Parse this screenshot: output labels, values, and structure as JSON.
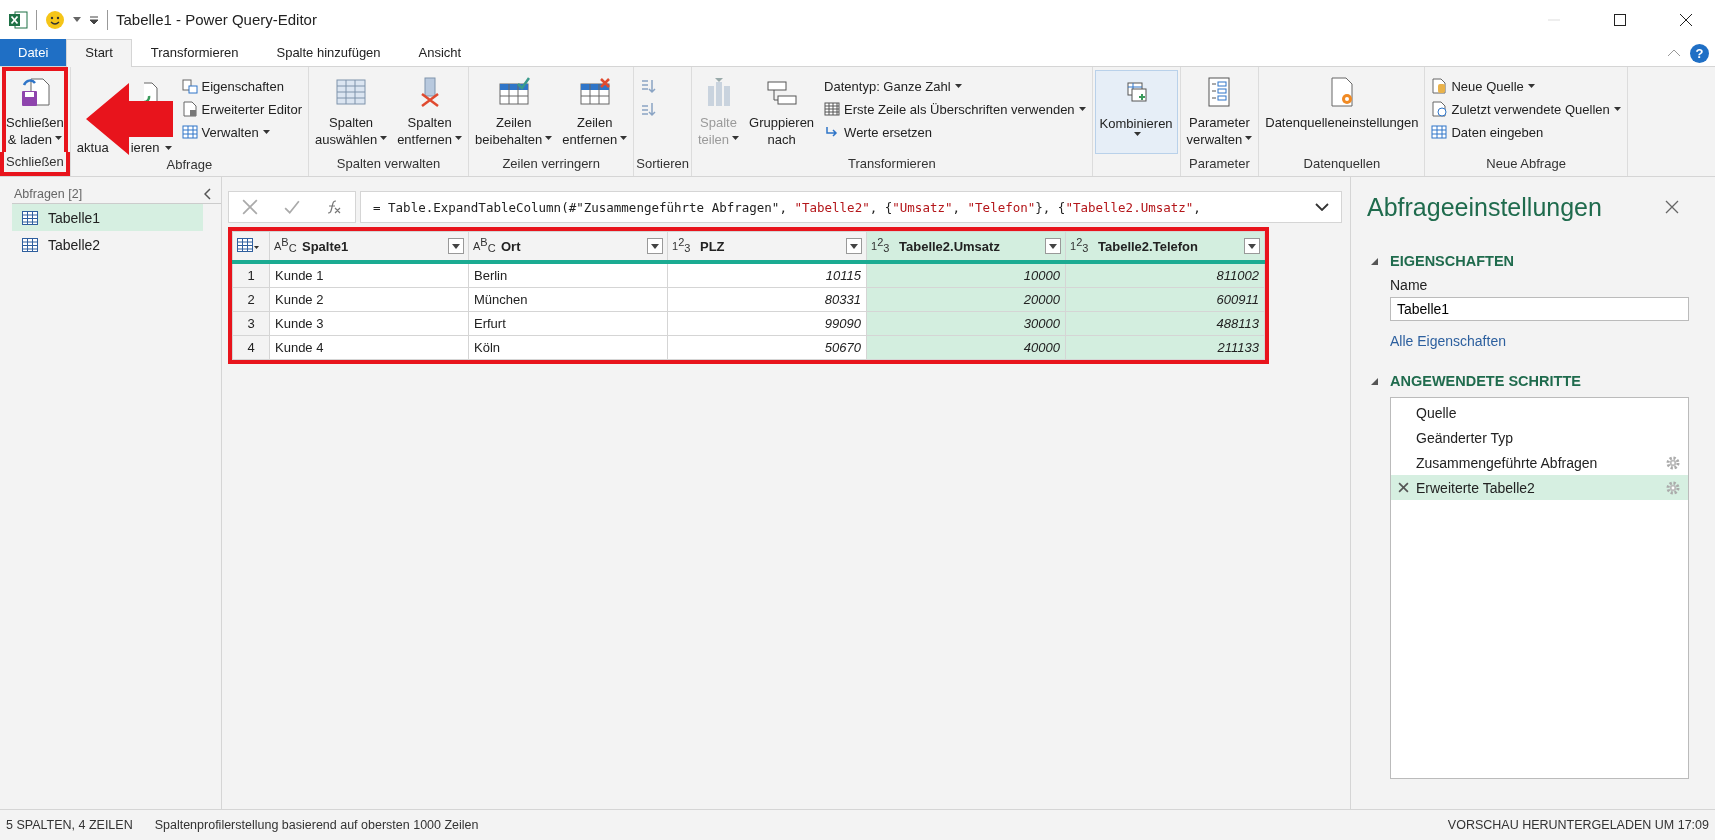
{
  "title_bar": {
    "title": "Tabelle1 - Power Query-Editor",
    "help_label": "?"
  },
  "tabs": [
    {
      "label": "Datei",
      "kind": "file",
      "selected": false
    },
    {
      "label": "Start",
      "kind": "tab",
      "selected": true
    },
    {
      "label": "Transformieren",
      "kind": "tab",
      "selected": false
    },
    {
      "label": "Spalte hinzufügen",
      "kind": "tab",
      "selected": false
    },
    {
      "label": "Ansicht",
      "kind": "tab",
      "selected": false
    }
  ],
  "ribbon": {
    "groups": [
      {
        "label": "Schließen",
        "buttons": [
          {
            "kind": "large",
            "lines": [
              "Schließen",
              "& laden"
            ],
            "dropdown": true,
            "disabled": false,
            "highlighted": false
          }
        ]
      },
      {
        "label": "Abfrage",
        "buttons": [
          {
            "kind": "large_covered",
            "lines": [
              "aktua",
              "ieren"
            ],
            "dropdown": true,
            "disabled": false,
            "highlighted": false
          },
          {
            "kind": "small",
            "lines": [
              "Eigenschaften"
            ],
            "dropdown": false,
            "disabled": false,
            "highlighted": false
          },
          {
            "kind": "small",
            "lines": [
              "Erweiterter Editor"
            ],
            "dropdown": false,
            "disabled": false,
            "highlighted": false
          },
          {
            "kind": "small",
            "lines": [
              "Verwalten"
            ],
            "dropdown": true,
            "disabled": false,
            "highlighted": false
          }
        ]
      },
      {
        "label": "Spalten verwalten",
        "buttons": [
          {
            "kind": "large",
            "lines": [
              "Spalten",
              "auswählen"
            ],
            "dropdown": true,
            "disabled": false,
            "highlighted": false
          },
          {
            "kind": "large",
            "lines": [
              "Spalten",
              "entfernen"
            ],
            "dropdown": true,
            "disabled": false,
            "highlighted": false
          }
        ]
      },
      {
        "label": "Zeilen verringern",
        "buttons": [
          {
            "kind": "large",
            "lines": [
              "Zeilen",
              "beibehalten"
            ],
            "dropdown": true,
            "disabled": false,
            "highlighted": false
          },
          {
            "kind": "large",
            "lines": [
              "Zeilen",
              "entfernen"
            ],
            "dropdown": true,
            "disabled": false,
            "highlighted": false
          }
        ]
      },
      {
        "label": "Sortieren",
        "buttons": [
          {
            "kind": "icon",
            "dropdown": false,
            "disabled": false,
            "highlighted": false
          },
          {
            "kind": "icon",
            "dropdown": false,
            "disabled": false,
            "highlighted": false
          }
        ]
      },
      {
        "label": "Transformieren",
        "buttons": [
          {
            "kind": "large",
            "lines": [
              "Spalte",
              "teilen"
            ],
            "dropdown": true,
            "disabled": true,
            "highlighted": false
          },
          {
            "kind": "large",
            "lines": [
              "Gruppieren",
              "nach"
            ],
            "dropdown": false,
            "disabled": false,
            "highlighted": false
          },
          {
            "kind": "small",
            "lines": [
              "Datentyp: Ganze Zahl"
            ],
            "dropdown": true,
            "disabled": false,
            "highlighted": false
          },
          {
            "kind": "small",
            "lines": [
              "Erste Zeile als Überschriften verwenden"
            ],
            "dropdown": true,
            "disabled": false,
            "highlighted": false
          },
          {
            "kind": "small",
            "lines": [
              "Werte ersetzen"
            ],
            "dropdown": false,
            "disabled": false,
            "highlighted": false
          }
        ]
      },
      {
        "buttons": [
          {
            "kind": "large",
            "lines": [
              "Kombinieren"
            ],
            "dropdown": true,
            "disabled": false,
            "highlighted": true
          }
        ]
      },
      {
        "label": "Parameter",
        "buttons": [
          {
            "kind": "large",
            "lines": [
              "Parameter",
              "verwalten"
            ],
            "dropdown": true,
            "disabled": false,
            "highlighted": false
          }
        ]
      },
      {
        "label": "Datenquellen",
        "buttons": [
          {
            "kind": "large",
            "lines": [
              "Datenquelleneinstellungen"
            ],
            "dropdown": false,
            "disabled": false,
            "highlighted": false
          }
        ]
      },
      {
        "label": "Neue Abfrage",
        "buttons": [
          {
            "kind": "small",
            "lines": [
              "Neue Quelle"
            ],
            "dropdown": true,
            "disabled": false,
            "highlighted": false
          },
          {
            "kind": "small",
            "lines": [
              "Zuletzt verwendete Quellen"
            ],
            "dropdown": true,
            "disabled": false,
            "highlighted": false
          },
          {
            "kind": "small",
            "lines": [
              "Daten eingeben"
            ],
            "dropdown": false,
            "disabled": false,
            "highlighted": false
          }
        ]
      }
    ]
  },
  "callouts": {
    "close_button_box": true,
    "arrow": true,
    "table_box": true
  },
  "queries_panel": {
    "header": "Abfragen [2]",
    "items": [
      {
        "label": "Tabelle1",
        "selected": true
      },
      {
        "label": "Tabelle2",
        "selected": false
      }
    ]
  },
  "formula_bar": {
    "segments": [
      {
        "kind": "code",
        "text": "= Table.ExpandTableColumn(#\"Zusammengeführte Abfragen\", "
      },
      {
        "kind": "string",
        "text": "\"Tabelle2\""
      },
      {
        "kind": "code",
        "text": ", {"
      },
      {
        "kind": "string",
        "text": "\"Umsatz\""
      },
      {
        "kind": "code",
        "text": ", "
      },
      {
        "kind": "string",
        "text": "\"Telefon\""
      },
      {
        "kind": "code",
        "text": "}, {"
      },
      {
        "kind": "string",
        "text": "\"Tabelle2.Umsatz\""
      },
      {
        "kind": "code",
        "text": ","
      }
    ]
  },
  "table": {
    "columns": [
      {
        "name": "Spalte1",
        "type_label": "ABC",
        "kind": "text",
        "highlighted": false
      },
      {
        "name": "Ort",
        "type_label": "ABC",
        "kind": "text",
        "highlighted": false
      },
      {
        "name": "PLZ",
        "type_label": "123",
        "kind": "number",
        "highlighted": false
      },
      {
        "name": "Tabelle2.Umsatz",
        "type_label": "123",
        "kind": "number",
        "highlighted": true
      },
      {
        "name": "Tabelle2.Telefon",
        "type_label": "123",
        "kind": "number",
        "highlighted": true
      }
    ],
    "rows": [
      {
        "number": "1",
        "cells": [
          "Kunde 1",
          "Berlin",
          "10115",
          "10000",
          "811002"
        ]
      },
      {
        "number": "2",
        "cells": [
          "Kunde 2",
          "München",
          "80331",
          "20000",
          "600911"
        ]
      },
      {
        "number": "3",
        "cells": [
          "Kunde 3",
          "Erfurt",
          "99090",
          "30000",
          "488113"
        ]
      },
      {
        "number": "4",
        "cells": [
          "Kunde 4",
          "Köln",
          "50670",
          "40000",
          "211133"
        ]
      }
    ]
  },
  "settings_panel": {
    "title": "Abfrageeinstellungen",
    "properties": {
      "heading": "EIGENSCHAFTEN",
      "name_label": "Name",
      "name_value": "Tabelle1",
      "link": "Alle Eigenschaften"
    },
    "steps_heading": "ANGEWENDETE SCHRITTE",
    "steps": [
      {
        "label": "Quelle",
        "selected": false,
        "has_settings": false
      },
      {
        "label": "Geänderter Typ",
        "selected": false,
        "has_settings": false
      },
      {
        "label": "Zusammengeführte Abfragen",
        "selected": false,
        "has_settings": true
      },
      {
        "label": "Erweiterte Tabelle2",
        "selected": true,
        "has_settings": true
      }
    ]
  },
  "status_bar": {
    "left": [
      "5 SPALTEN, 4 ZEILEN",
      "Spaltenprofilerstellung basierend auf obersten 1000 Zeilen"
    ],
    "right": "VORSCHAU HERUNTERGELADEN UM 17:09"
  }
}
